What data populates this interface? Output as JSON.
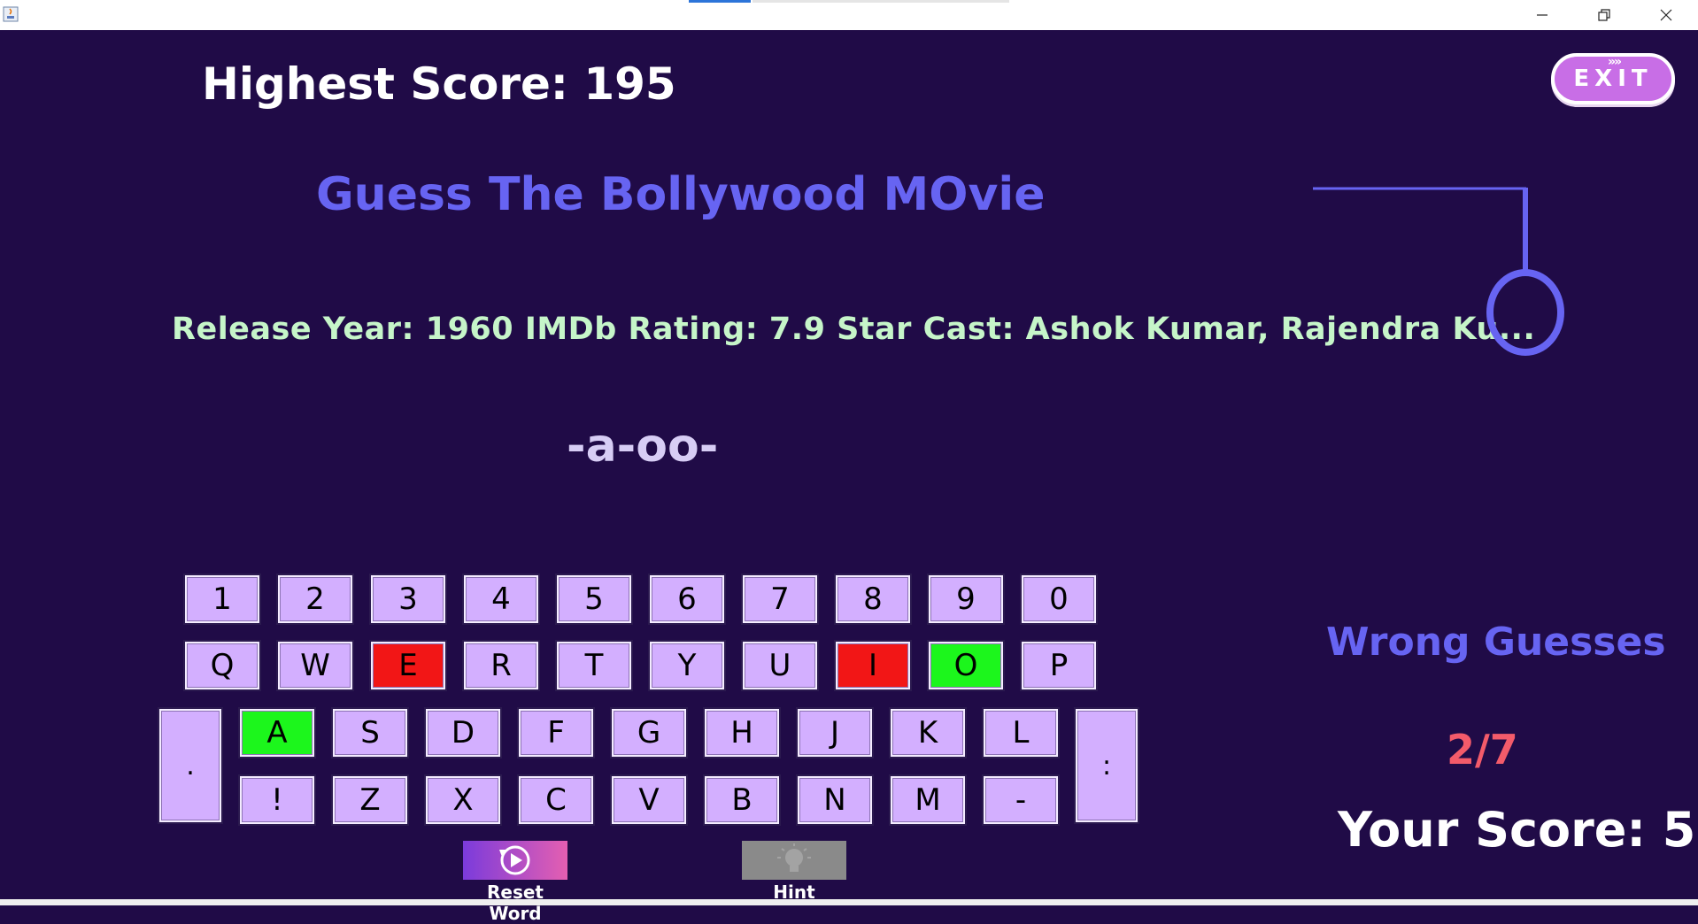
{
  "header": {
    "highest_score": "Highest Score: 195",
    "title": "Guess The Bollywood MOvie",
    "info": "Release Year: 1960 IMDb Rating: 7.9 Star Cast: Ashok Kumar, Rajendra Ku...",
    "masked_word": "-a-oo-"
  },
  "exit_label": "EXIT",
  "keyboard": {
    "row1": [
      "1",
      "2",
      "3",
      "4",
      "5",
      "6",
      "7",
      "8",
      "9",
      "0"
    ],
    "row2": [
      "Q",
      "W",
      "E",
      "R",
      "T",
      "Y",
      "U",
      "I",
      "O",
      "P"
    ],
    "row3": [
      "A",
      "S",
      "D",
      "F",
      "G",
      "H",
      "J",
      "K",
      "L"
    ],
    "row4": [
      "!",
      "Z",
      "X",
      "C",
      "V",
      "B",
      "N",
      "M",
      "-"
    ],
    "left_tall": ".",
    "right_tall": ":"
  },
  "key_states": {
    "E": "wrong",
    "I": "wrong",
    "O": "right",
    "A": "right"
  },
  "status": {
    "wrong_title": "Wrong Guesses",
    "wrong_count": "2/7",
    "score": "Your Score: 5"
  },
  "buttons": {
    "reset_label": "Reset Word",
    "hint_label": "Hint"
  },
  "colors": {
    "background": "#200b47",
    "accent": "#6764f2",
    "key": "#d3afff",
    "wrong": "#f21616",
    "correct": "#1cf61c",
    "info_text": "#c6f5c9",
    "count": "#f35b6a"
  }
}
